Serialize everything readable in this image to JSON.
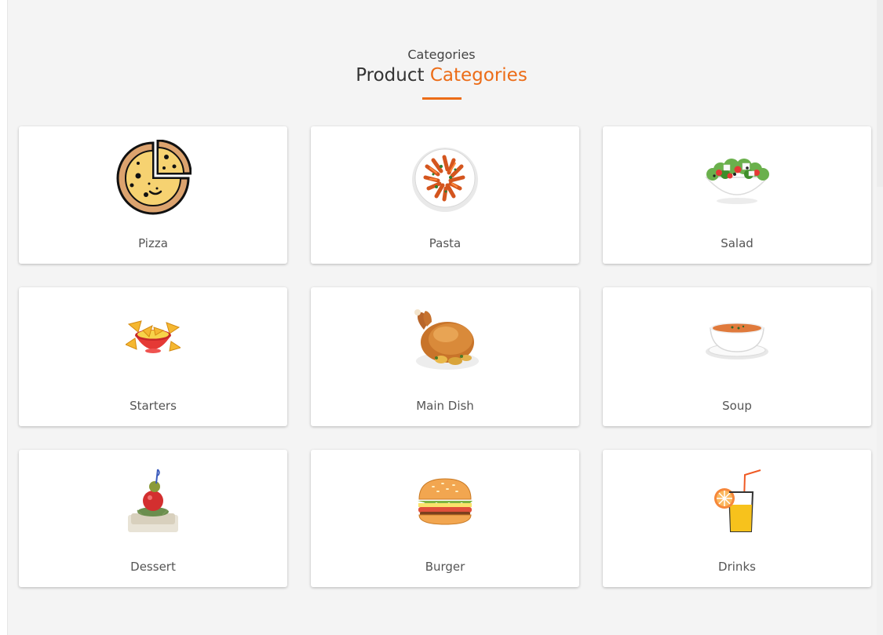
{
  "header": {
    "eyebrow": "Categories",
    "title_main": "Product ",
    "title_accent": "Categories"
  },
  "colors": {
    "accent": "#ec6c17",
    "background": "#f4f4f4",
    "card": "#ffffff"
  },
  "categories": [
    {
      "label": "Pizza",
      "icon": "pizza-icon"
    },
    {
      "label": "Pasta",
      "icon": "pasta-plate-image"
    },
    {
      "label": "Salad",
      "icon": "salad-bowl-image"
    },
    {
      "label": "Starters",
      "icon": "nachos-icon"
    },
    {
      "label": "Main Dish",
      "icon": "roast-chicken-image"
    },
    {
      "label": "Soup",
      "icon": "soup-bowl-image"
    },
    {
      "label": "Dessert",
      "icon": "dessert-image"
    },
    {
      "label": "Burger",
      "icon": "burger-icon"
    },
    {
      "label": "Drinks",
      "icon": "drink-icon"
    }
  ]
}
